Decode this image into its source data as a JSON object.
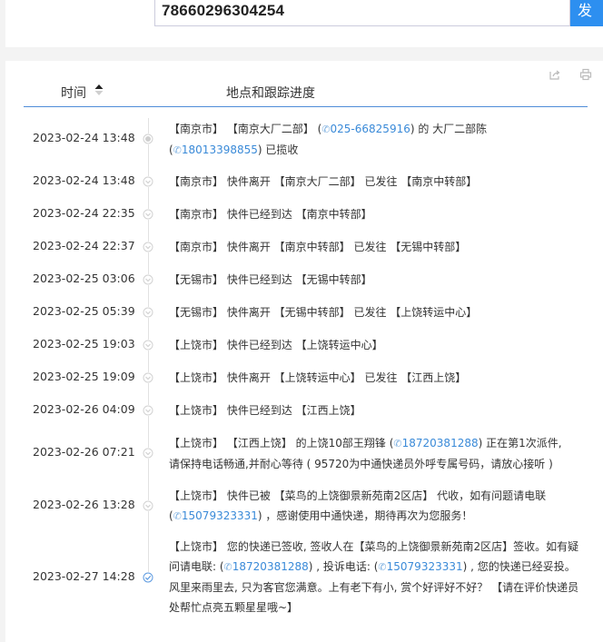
{
  "tracking": {
    "number": "78660296304254",
    "button_label": "发"
  },
  "table_head": {
    "time": "时间",
    "place": "地点和跟踪进度"
  },
  "colors": {
    "accent": "#2d8ff0",
    "phone": "#3a8ad8",
    "divider": "#4f8dd8"
  },
  "events": [
    {
      "time": "2023-02-24 13:48",
      "icon": "dot-icon",
      "lines": [
        [
          {
            "t": "【南京市】 【南京大厂二部】 ("
          },
          {
            "t": "025-66825916",
            "phone": true
          },
          {
            "t": ") 的 大厂二部陈"
          }
        ],
        [
          {
            "t": "("
          },
          {
            "t": "18013398855",
            "phone": true
          },
          {
            "t": ") 已揽收"
          }
        ]
      ]
    },
    {
      "time": "2023-02-24 13:48",
      "icon": "chevron-down-icon",
      "lines": [
        [
          {
            "t": "【南京市】 快件离开 【南京大厂二部】 已发往 【南京中转部】"
          }
        ]
      ]
    },
    {
      "time": "2023-02-24 22:35",
      "icon": "chevron-down-icon",
      "lines": [
        [
          {
            "t": "【南京市】 快件已经到达 【南京中转部】"
          }
        ]
      ]
    },
    {
      "time": "2023-02-24 22:37",
      "icon": "chevron-down-icon",
      "lines": [
        [
          {
            "t": "【南京市】 快件离开 【南京中转部】 已发往 【无锡中转部】"
          }
        ]
      ]
    },
    {
      "time": "2023-02-25 03:06",
      "icon": "chevron-down-icon",
      "lines": [
        [
          {
            "t": "【无锡市】 快件已经到达 【无锡中转部】"
          }
        ]
      ]
    },
    {
      "time": "2023-02-25 05:39",
      "icon": "chevron-down-icon",
      "lines": [
        [
          {
            "t": "【无锡市】 快件离开 【无锡中转部】 已发往 【上饶转运中心】"
          }
        ]
      ]
    },
    {
      "time": "2023-02-25 19:03",
      "icon": "chevron-down-icon",
      "lines": [
        [
          {
            "t": "【上饶市】 快件已经到达 【上饶转运中心】"
          }
        ]
      ]
    },
    {
      "time": "2023-02-25 19:09",
      "icon": "chevron-down-icon",
      "lines": [
        [
          {
            "t": "【上饶市】 快件离开 【上饶转运中心】 已发往 【江西上饶】"
          }
        ]
      ]
    },
    {
      "time": "2023-02-26 04:09",
      "icon": "chevron-down-icon",
      "lines": [
        [
          {
            "t": "【上饶市】 快件已经到达 【江西上饶】"
          }
        ]
      ]
    },
    {
      "time": "2023-02-26 07:21",
      "icon": "chevron-down-icon",
      "lines": [
        [
          {
            "t": "【上饶市】 【江西上饶】 的上饶10部王翔锋 ("
          },
          {
            "t": "18720381288",
            "phone": true
          },
          {
            "t": ") 正在第1次派件,"
          }
        ],
        [
          {
            "t": "请保持电话畅通,并耐心等待 ( 95720为中通快递员外呼专属号码，请放心接听 )"
          }
        ]
      ]
    },
    {
      "time": "2023-02-26 13:28",
      "icon": "chevron-down-icon",
      "lines": [
        [
          {
            "t": "【上饶市】 快件已被 【菜鸟的上饶御景新苑南2区店】 代收，如有问题请电联"
          }
        ],
        [
          {
            "t": "("
          },
          {
            "t": "15079323331",
            "phone": true
          },
          {
            "t": ") ，感谢使用中通快递，期待再次为您服务！"
          }
        ]
      ]
    },
    {
      "time": "2023-02-27 14:28",
      "icon": "check-circle-icon",
      "lines": [
        [
          {
            "t": "【上饶市】 您的快递已签收, 签收人在【菜鸟的上饶御景新苑南2区店】签收。如有疑"
          }
        ],
        [
          {
            "t": "问请电联: ("
          },
          {
            "t": "18720381288",
            "phone": true
          },
          {
            "t": ") , 投诉电话: ("
          },
          {
            "t": "15079323331",
            "phone": true
          },
          {
            "t": ") , 您的快递已经妥投。"
          }
        ],
        [
          {
            "t": "风里来雨里去, 只为客官您满意。上有老下有小, 赏个好评好不好？ 【请在评价快递员"
          }
        ],
        [
          {
            "t": "处帮忙点亮五颗星星哦~】"
          }
        ]
      ]
    }
  ]
}
